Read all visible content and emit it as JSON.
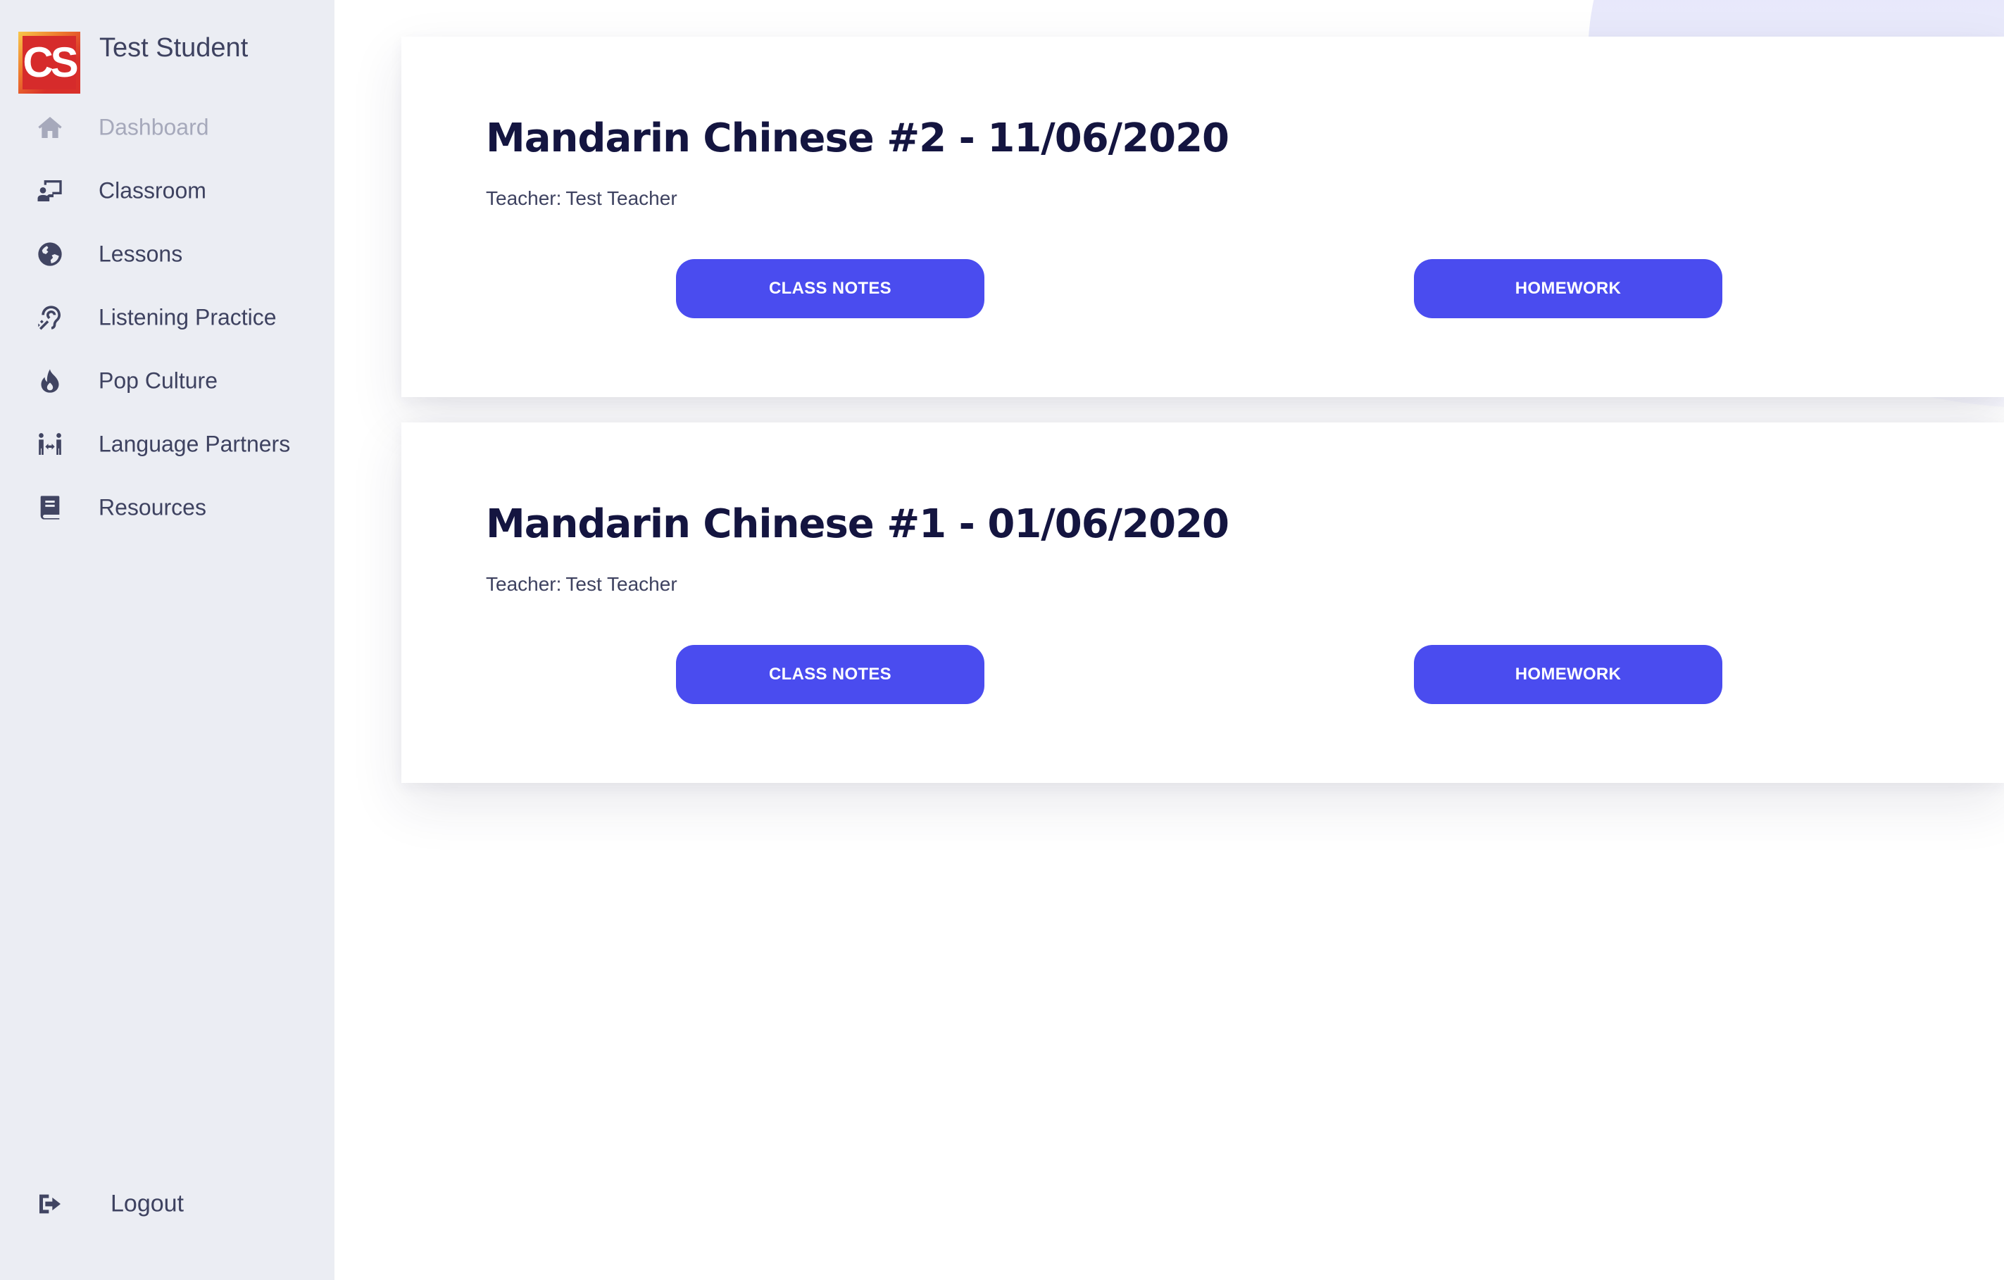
{
  "brand": {
    "logo_text": "CS",
    "user_name": "Test Student"
  },
  "nav": {
    "items": [
      {
        "label": "Dashboard",
        "icon": "home-icon",
        "active": true
      },
      {
        "label": "Classroom",
        "icon": "classroom-icon"
      },
      {
        "label": "Lessons",
        "icon": "globe-icon"
      },
      {
        "label": "Listening Practice",
        "icon": "assistive-listening-icon"
      },
      {
        "label": "Pop Culture",
        "icon": "fire-icon"
      },
      {
        "label": "Language Partners",
        "icon": "people-arrows-icon"
      },
      {
        "label": "Resources",
        "icon": "book-icon"
      }
    ],
    "logout_label": "Logout"
  },
  "lessons": [
    {
      "title": "Mandarin Chinese #2 - 11/06/2020",
      "teacher_label": "Teacher:",
      "teacher_name": "Test Teacher",
      "notes_label": "CLASS NOTES",
      "homework_label": "HOMEWORK"
    },
    {
      "title": "Mandarin Chinese #1 - 01/06/2020",
      "teacher_label": "Teacher:",
      "teacher_name": "Test Teacher",
      "notes_label": "CLASS NOTES",
      "homework_label": "HOMEWORK"
    }
  ],
  "colors": {
    "accent": "#4a4cef",
    "sidebar_bg": "#ebedf3",
    "title": "#141540",
    "text": "#3e4260",
    "muted": "#a6a9bb"
  }
}
